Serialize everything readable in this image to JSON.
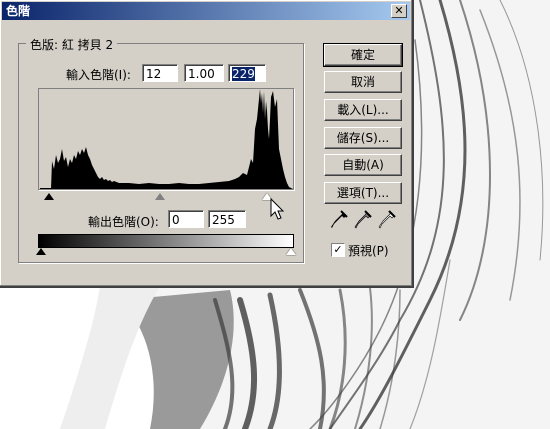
{
  "dialog": {
    "title": "色階",
    "close_glyph": "✕",
    "channel": "色版: 紅 拷貝 2",
    "input_levels_label": "輸入色階(I):",
    "input_levels": [
      "12",
      "1.00",
      "229"
    ],
    "output_levels_label": "輸出色階(O):",
    "output_levels": [
      "0",
      "255"
    ],
    "buttons": [
      "確定",
      "取消",
      "載入(L)...",
      "儲存(S)...",
      "自動(A)",
      "選項(T)..."
    ],
    "preview_label": "預視(P)",
    "preview_checked": true,
    "eyedroppers": [
      "black-eyedropper-icon",
      "gray-eyedropper-icon",
      "white-eyedropper-icon"
    ]
  }
}
